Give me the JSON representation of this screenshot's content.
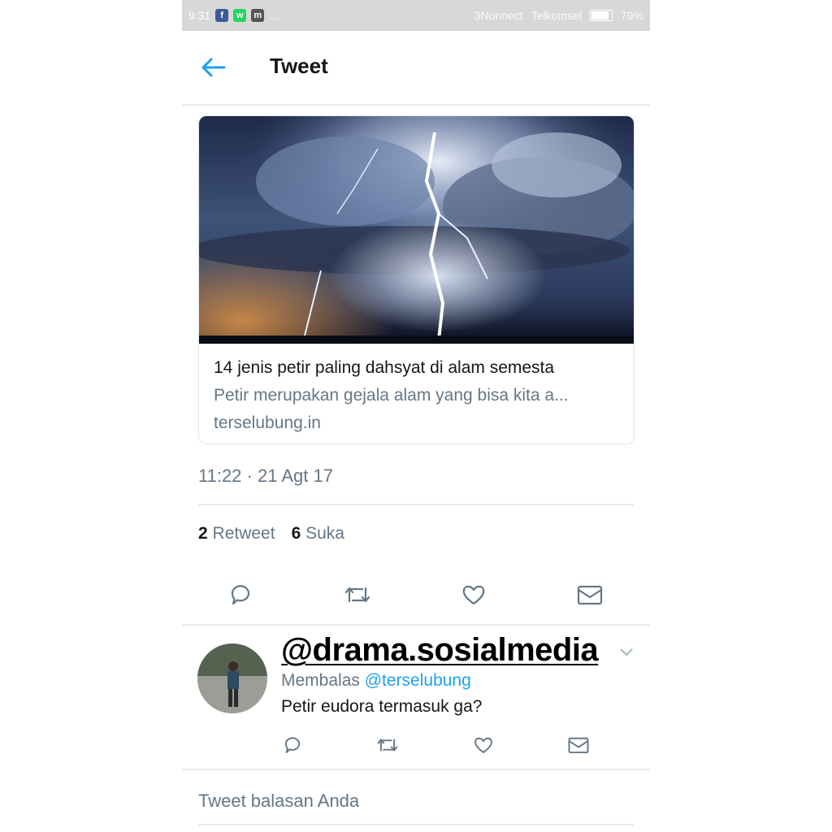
{
  "status_bar": {
    "time": "9:31",
    "apps": [
      {
        "name": "facebook",
        "glyph": "f",
        "color": "#3b5998"
      },
      {
        "name": "whatsapp",
        "glyph": "w",
        "color": "#25d366"
      },
      {
        "name": "messenger",
        "glyph": "m",
        "color": "#555555"
      }
    ],
    "ellipsis": "...",
    "carrier_left": "3Nonnect",
    "carrier_right": "Telkomsel",
    "battery_level": 0.79,
    "battery_text": "79%"
  },
  "header": {
    "back_icon": "arrow-left-icon",
    "title": "Tweet",
    "accent": "#1da1f2"
  },
  "link_card": {
    "image_subject": "storm-lightning-photo",
    "title": "14 jenis petir paling dahsyat di alam semesta",
    "description": "Petir merupakan gejala alam yang bisa kita a...",
    "domain": "terselubung.in"
  },
  "tweet": {
    "timestamp": "11:22 · 21 Agt 17",
    "retweet_count": "2",
    "retweet_label": "Retweet",
    "like_count": "6",
    "like_label": "Suka",
    "actions": [
      "reply-icon",
      "retweet-icon",
      "heart-icon",
      "mail-icon"
    ]
  },
  "reply": {
    "overlay_handle": "@drama.sosialmedia",
    "replying_prefix": "Membalas",
    "replying_handle": "@terselubung",
    "text": "Petir eudora termasuk ga?"
  },
  "compose": {
    "placeholder": "Tweet balasan Anda"
  }
}
